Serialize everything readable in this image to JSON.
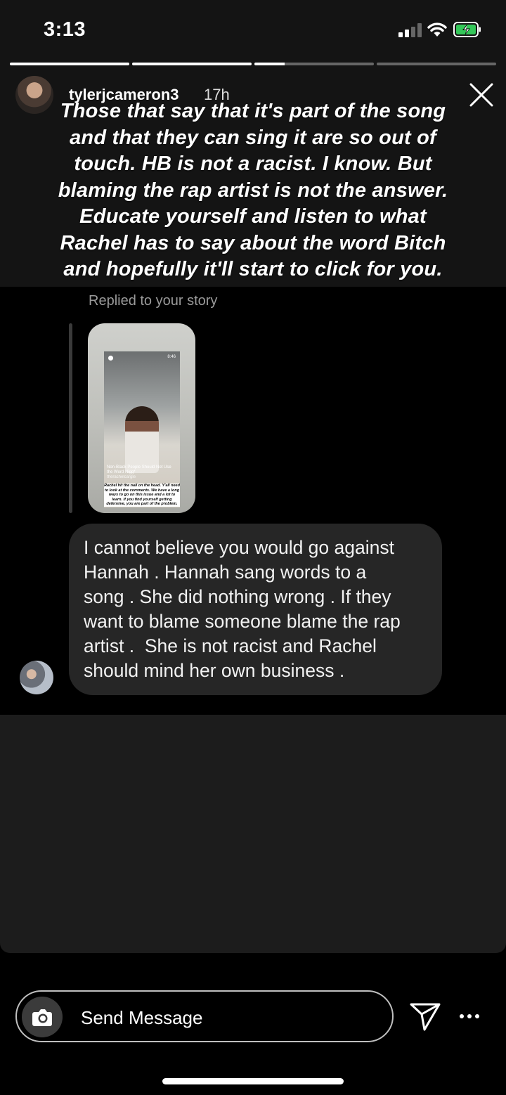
{
  "status_bar": {
    "time": "3:13",
    "battery_charging": true
  },
  "story": {
    "progress": [
      1.0,
      1.0,
      0.25,
      0.0
    ],
    "username": "tylerjcameron3",
    "age": "17h",
    "caption_lines": [
      "Those that say that it's part of the song",
      "and that they can sing it are so out of",
      "touch. HB is not a racist. I know. But",
      "blaming the rap artist is not the answer.",
      "Educate yourself and listen to what",
      "Rachel has to say about the word Bitch",
      "and hopefully it'll start to click for you."
    ]
  },
  "reply": {
    "label": "Replied to your story",
    "thumbnail": {
      "clock": "8:46",
      "headline": "Non-Black People Should Not Use the Word Nigg*",
      "handle": "therachelcargle",
      "caption": "Rachel hit the nail on the head. Y'all need to look at the comments. We have a long ways to go on this issue and a lot to learn. If you find yourself getting defensive, you are part of the problem."
    },
    "message_lines": [
      "I cannot believe you would go against",
      "Hannah . Hannah sang words to a",
      "song . She did nothing wrong . If they",
      "want to blame someone blame the rap",
      "artist .  She is not racist and Rachel",
      "should mind her own business ."
    ]
  },
  "composer": {
    "placeholder": "Send Message"
  },
  "icons": {
    "camera": "camera-icon",
    "send": "paper-plane-icon",
    "more": "more-dots-icon",
    "close": "close-icon"
  },
  "colors": {
    "battery_fill": "#34c759",
    "bubble": "#262626",
    "panel": "#1c1c1c"
  }
}
